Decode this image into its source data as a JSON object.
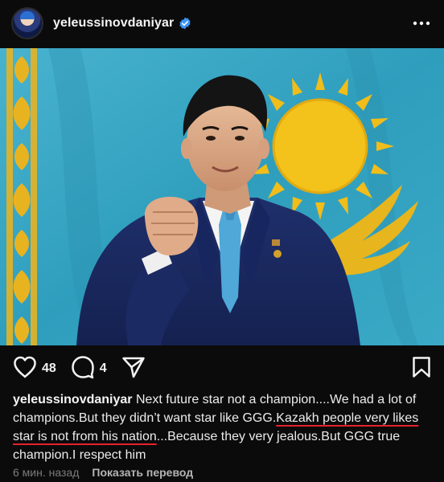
{
  "header": {
    "username": "yeleussinovdaniyar",
    "verified_icon": "verified-badge-icon",
    "more_icon": "more-dots-icon"
  },
  "post": {
    "image_alt": "Man in navy suit with raised fist in front of Kazakhstan flag",
    "flag_color": "#3aa6c3",
    "sun_color": "#f3c21b"
  },
  "actions": {
    "likes": "48",
    "comments": "4",
    "like_icon": "heart-icon",
    "comment_icon": "comment-icon",
    "share_icon": "share-icon",
    "save_icon": "bookmark-icon"
  },
  "caption": {
    "username": "yeleussinovdaniyar",
    "part1": " Next future star not a champion....We had a lot of champions.But they didn’t want star like GGG.",
    "underlined": "Kazakh people very likes star is not from his nation",
    "part2": "...Because they very jealous.But GGG true champion.I respect him",
    "underline_color": "#e5222b"
  },
  "footer": {
    "time": "6 мин. назад",
    "translate": "Показать перевод"
  }
}
